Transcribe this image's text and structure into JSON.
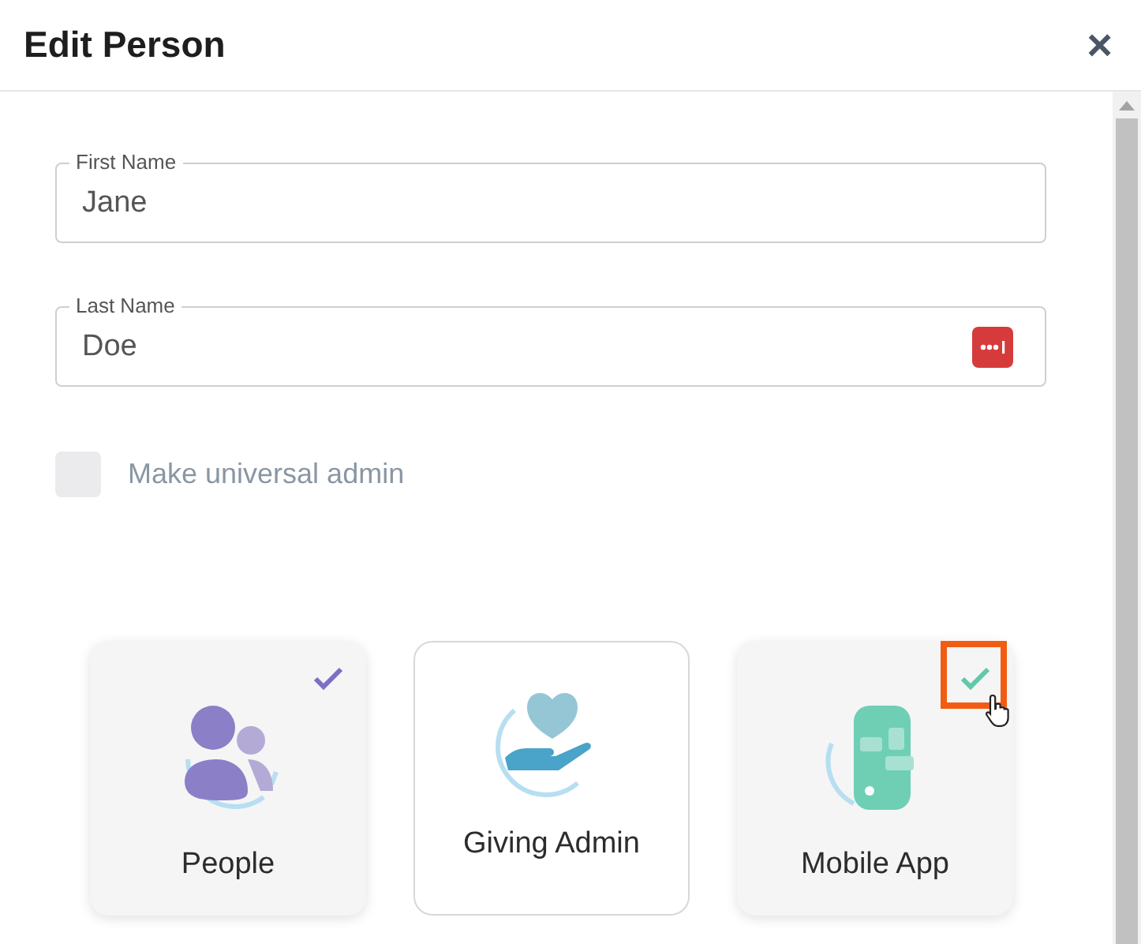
{
  "dialog": {
    "title": "Edit Person",
    "close": "×"
  },
  "fields": [
    {
      "label": "First Name",
      "value": "Jane",
      "password_manager": false
    },
    {
      "label": "Last Name",
      "value": "Doe",
      "password_manager": true
    }
  ],
  "admin_checkbox": {
    "label": "Make universal admin",
    "checked": false
  },
  "cards": [
    {
      "label": "People",
      "kind": "people",
      "selected": true,
      "highlighted": false
    },
    {
      "label": "Giving Admin",
      "kind": "giving",
      "selected": false,
      "highlighted": false
    },
    {
      "label": "Mobile App",
      "kind": "mobile",
      "selected": true,
      "highlighted": true
    }
  ]
}
